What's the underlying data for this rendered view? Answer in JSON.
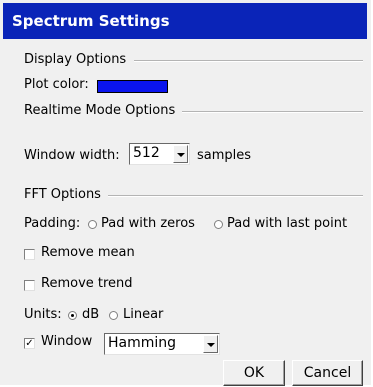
{
  "window": {
    "title": "Spectrum Settings"
  },
  "display_options": {
    "header": "Display Options",
    "plot_color_label": "Plot color:",
    "plot_color": "#0a14ee"
  },
  "realtime_options": {
    "header": "Realtime Mode Options",
    "window_width_label": "Window width:",
    "window_width_value": "512",
    "window_width_unit": "samples"
  },
  "fft_options": {
    "header": "FFT Options",
    "padding_label": "Padding:",
    "pad_zeros_label": "Pad with zeros",
    "pad_last_label": "Pad with last point",
    "remove_mean_label": "Remove mean",
    "remove_trend_label": "Remove trend",
    "units_label": "Units:",
    "units_db_label": "dB",
    "units_linear_label": "Linear",
    "window_label": "Window",
    "window_check_mark": "✓",
    "window_value": "Hamming"
  },
  "buttons": {
    "ok_label": "OK",
    "cancel_label": "Cancel"
  },
  "colors": {
    "title_bar": "#0a24b8",
    "dialog_bg": "#f0f0f0"
  }
}
